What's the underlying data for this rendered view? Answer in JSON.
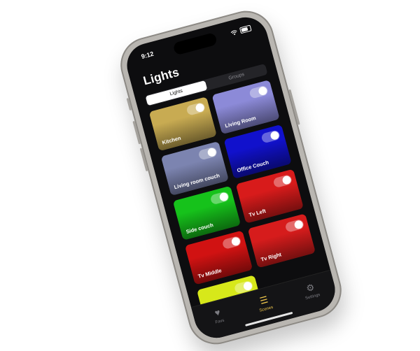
{
  "status": {
    "time": "9:12"
  },
  "screen": {
    "title": "Lights"
  },
  "segments": [
    {
      "label": "Lights",
      "active": true
    },
    {
      "label": "Groups",
      "active": false
    }
  ],
  "lights": [
    {
      "name": "Kitchen",
      "color": "#c8ab52",
      "on": true
    },
    {
      "name": "Living Room",
      "color": "#8c8ad8",
      "on": true
    },
    {
      "name": "Living room couch",
      "color": "#7c84b0",
      "on": true
    },
    {
      "name": "Office Couch",
      "color": "#1111cc",
      "on": true
    },
    {
      "name": "Side couch",
      "color": "#16c21b",
      "on": true
    },
    {
      "name": "Tv Left",
      "color": "#d81b1b",
      "on": true
    },
    {
      "name": "Tv Middle",
      "color": "#d11212",
      "on": true
    },
    {
      "name": "Tv Right",
      "color": "#d61c1c",
      "on": true
    },
    {
      "name": "",
      "color": "#d7e81a",
      "on": true
    }
  ],
  "tabs": [
    {
      "label": "Favs",
      "icon": "heart-icon",
      "glyph": "♥",
      "active": false
    },
    {
      "label": "Scenes",
      "icon": "scenes-icon",
      "glyph": "☰",
      "active": true
    },
    {
      "label": "Settings",
      "icon": "gear-icon",
      "glyph": "⚙",
      "active": false
    }
  ]
}
